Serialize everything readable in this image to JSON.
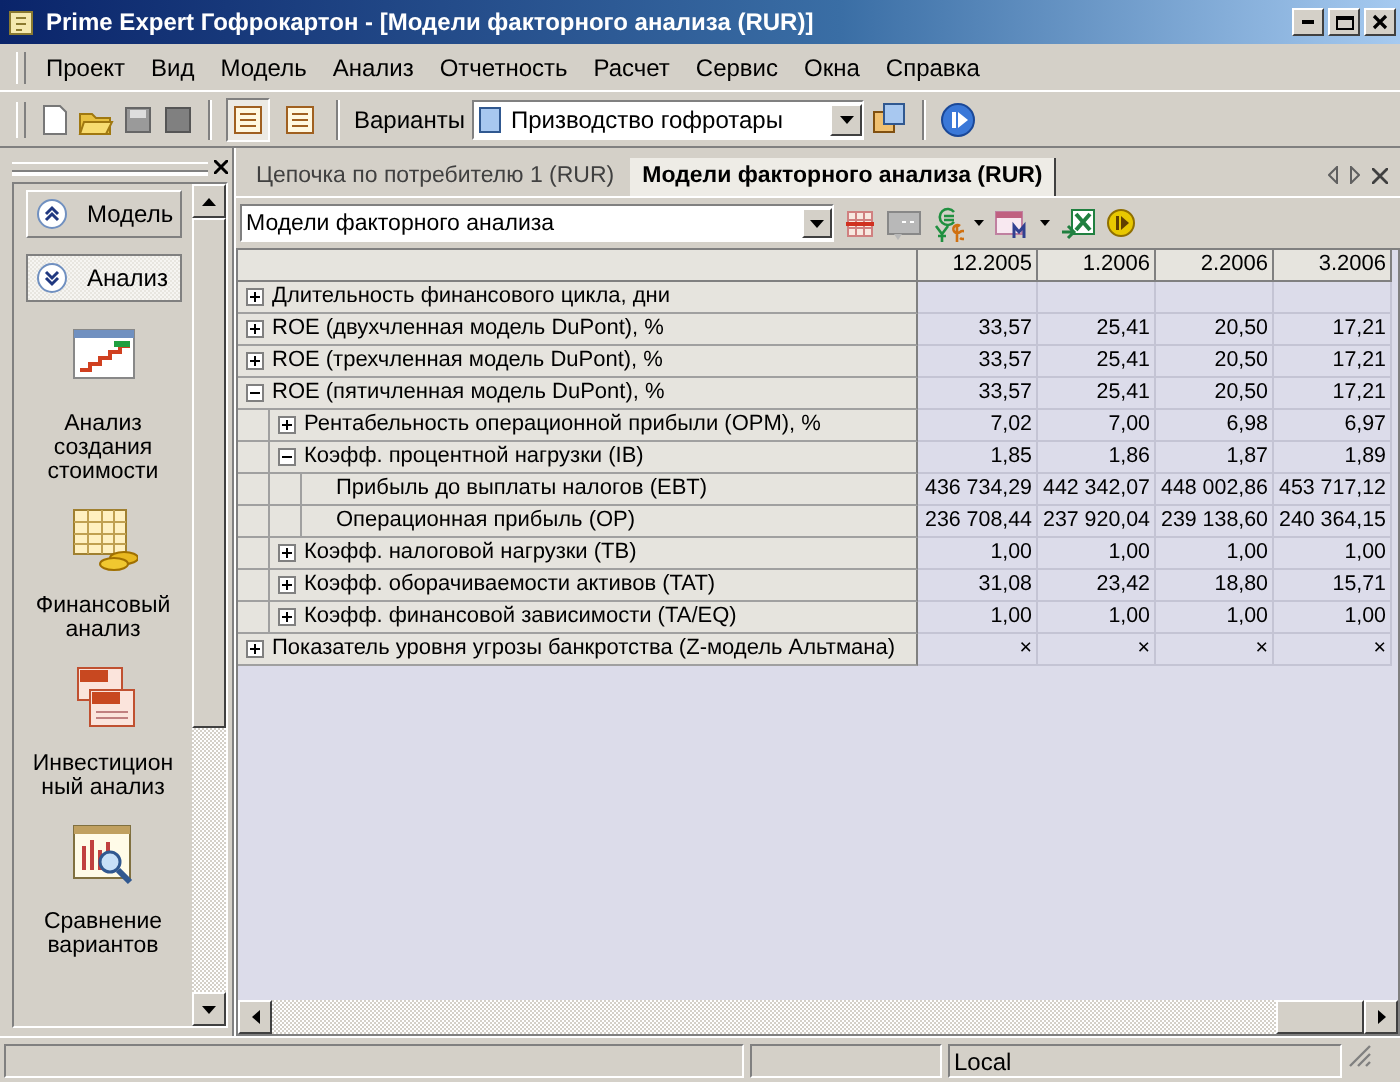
{
  "window": {
    "title": "Prime Expert Гофрокартон - [Модели факторного анализа (RUR)]"
  },
  "menu": [
    "Проект",
    "Вид",
    "Модель",
    "Анализ",
    "Отчетность",
    "Расчет",
    "Сервис",
    "Окна",
    "Справка"
  ],
  "toolbar": {
    "view_buttons": [
      {
        "selected": true
      },
      {
        "selected": false
      }
    ],
    "variants_label": "Варианты",
    "variant": "Призводство гофротары"
  },
  "sidebar": {
    "groups": [
      {
        "label": "Модель",
        "kind": "collapse",
        "selected": false
      },
      {
        "label": "Анализ",
        "kind": "expand",
        "selected": true
      }
    ],
    "items": [
      {
        "label": "Анализ создания стоимости",
        "kind": "value-chart"
      },
      {
        "label": "Финансовый анализ",
        "kind": "coins"
      },
      {
        "label": "Инвестицион ный анализ",
        "kind": "npv"
      },
      {
        "label": "Сравнение вариантов",
        "kind": "compare"
      }
    ]
  },
  "tabs": [
    {
      "label": "Цепочка по потребителю 1 (RUR)",
      "selected": false
    },
    {
      "label": "Модели факторного анализа (RUR)",
      "selected": true
    }
  ],
  "model_select": {
    "value": "Модели факторного анализа"
  },
  "table": {
    "columns": [
      "12.2005",
      "1.2006",
      "2.2006",
      "3.2006"
    ],
    "rows": [
      {
        "label": "Длительность финансового цикла, дни",
        "expanded": false
      },
      {
        "label": "ROE (двухчленная модель DuPont), %",
        "expanded": false,
        "values": [
          "33,57",
          "25,41",
          "20,50",
          "17,21"
        ]
      },
      {
        "label": "ROE (трехчленная модель DuPont), %",
        "expanded": false,
        "values": [
          "33,57",
          "25,41",
          "20,50",
          "17,21"
        ]
      },
      {
        "label": "ROE (пятичленная модель DuPont), %",
        "expanded": true,
        "values": [
          "33,57",
          "25,41",
          "20,50",
          "17,21"
        ],
        "children": [
          {
            "label": "Рентабельность операционной прибыли (OPM), %",
            "expanded": false,
            "values": [
              "7,02",
              "7,00",
              "6,98",
              "6,97"
            ]
          },
          {
            "label": "Коэфф. процентной нагрузки (IB)",
            "expanded": true,
            "values": [
              "1,85",
              "1,86",
              "1,87",
              "1,89"
            ],
            "children": [
              {
                "label": "Прибыль до выплаты налогов (EBT)",
                "values": [
                  "436 734,29",
                  "442 342,07",
                  "448 002,86",
                  "453 717,12"
                ]
              },
              {
                "label": "Операционная прибыль (OP)",
                "values": [
                  "236 708,44",
                  "237 920,04",
                  "239 138,60",
                  "240 364,15"
                ]
              }
            ]
          },
          {
            "label": "Коэфф. налоговой нагрузки (TB)",
            "expanded": false,
            "values": [
              "1,00",
              "1,00",
              "1,00",
              "1,00"
            ]
          },
          {
            "label": "Коэфф. оборачиваемости активов (TAT)",
            "expanded": false,
            "values": [
              "31,08",
              "23,42",
              "18,80",
              "15,71"
            ]
          },
          {
            "label": "Коэфф. финансовой зависимости (TA/EQ)",
            "expanded": false,
            "values": [
              "1,00",
              "1,00",
              "1,00",
              "1,00"
            ]
          }
        ]
      },
      {
        "label": "Показатель уровня угрозы банкротства (Z-модель Альтмана)",
        "expanded": false,
        "values": [
          "×",
          "×",
          "×",
          "×"
        ]
      }
    ]
  },
  "status_bar": {
    "text": "Local"
  }
}
